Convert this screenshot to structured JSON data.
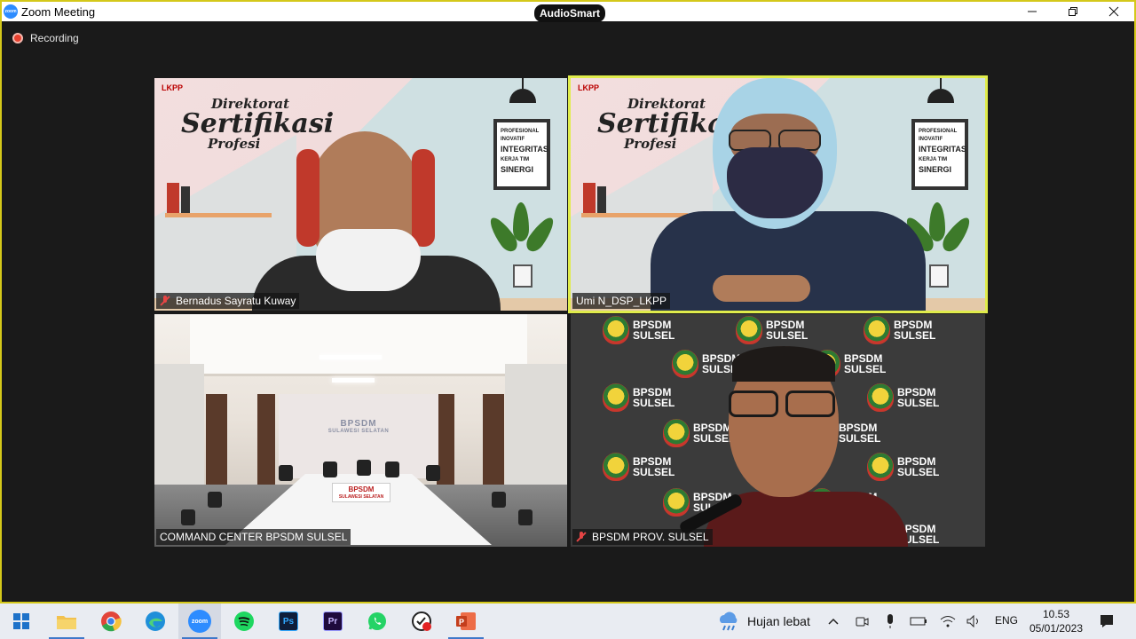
{
  "window": {
    "title": "Zoom Meeting",
    "badge": "AudioSmart",
    "app_icon_text": "zoom"
  },
  "recording": {
    "label": "Recording"
  },
  "tiles": [
    {
      "name": "Bernadus Sayratu Kuway",
      "muted": true,
      "background": "studio"
    },
    {
      "name": "Umi N_DSP_LKPP",
      "muted": false,
      "background": "studio",
      "active_speaker": true
    },
    {
      "name": "COMMAND CENTER BPSDM SULSEL",
      "muted": false,
      "background": "room"
    },
    {
      "name": "BPSDM PROV. SULSEL",
      "muted": true,
      "background": "backdrop"
    }
  ],
  "studio_bg": {
    "logo": "LKPP",
    "line1": "Direktorat",
    "line2": "Sertifikasi",
    "line3": "Profesi",
    "frame_lines": [
      "PROFESIONAL",
      "INOVATIF",
      "INTEGRITAS",
      "KERJA TIM",
      "SINERGI"
    ]
  },
  "room_bg": {
    "wall_title": "BPSDM",
    "wall_subtitle": "SULAWESI SELATAN",
    "podium_title": "BPSDM",
    "podium_subtitle": "SULAWESI SELATAN"
  },
  "backdrop_bg": {
    "line1": "BPSDM",
    "line2": "SULSEL"
  },
  "taskbar": {
    "apps": [
      "windows-start",
      "file-explorer",
      "chrome",
      "edge",
      "zoom",
      "spotify",
      "photoshop",
      "premiere",
      "whatsapp",
      "recorder",
      "powerpoint"
    ],
    "active_app": "zoom",
    "zoom_label": "zoom",
    "photoshop_label": "Ps",
    "premiere_label": "Pr",
    "weather": "Hujan lebat",
    "language": "ENG",
    "time": "10.53",
    "date": "05/01/2023"
  },
  "colors": {
    "active_speaker": "#e0ec4b",
    "window_border": "#d4c81a",
    "recording": "#e8412f",
    "muted": "#e64545",
    "zoom_blue": "#2d8cff"
  }
}
